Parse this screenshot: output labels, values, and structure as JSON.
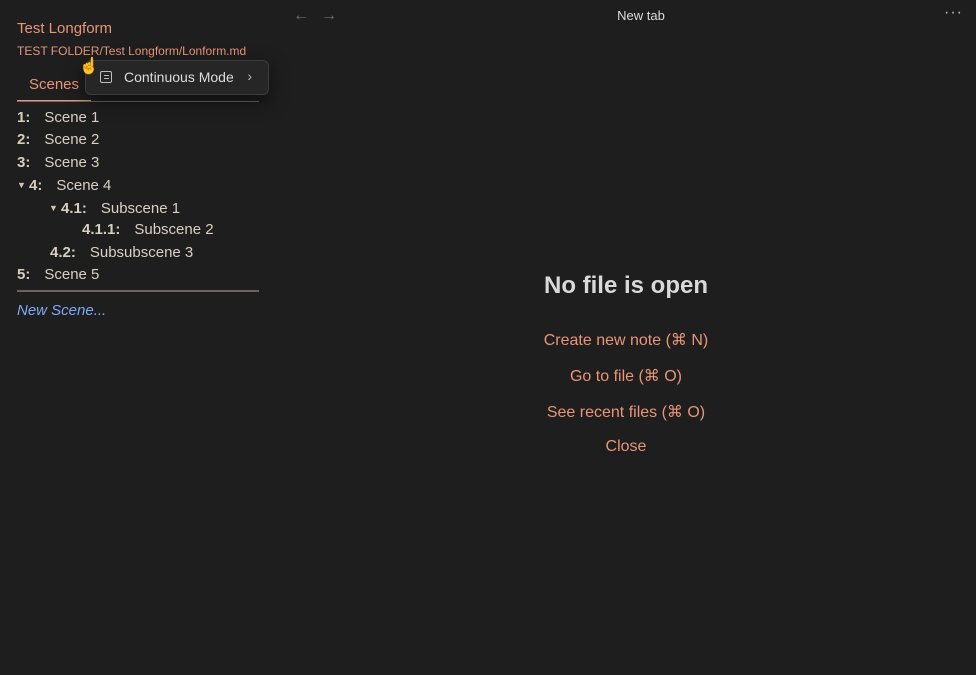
{
  "sidebar": {
    "project_title": "Test Longform",
    "project_path": "TEST FOLDER/Test Longform/Lonform.md",
    "tab_scenes": "Scenes",
    "scenes": [
      {
        "num": "1:",
        "name": "Scene 1",
        "toggle": ""
      },
      {
        "num": "2:",
        "name": "Scene 2",
        "toggle": ""
      },
      {
        "num": "3:",
        "name": "Scene 3",
        "toggle": ""
      },
      {
        "num": "4:",
        "name": "Scene 4",
        "toggle": "▼"
      },
      {
        "num": "4.1:",
        "name": "Subscene 1",
        "toggle": "▼"
      },
      {
        "num": "4.1.1:",
        "name": "Subscene 2",
        "toggle": ""
      },
      {
        "num": "4.2:",
        "name": "Subsubscene 3",
        "toggle": ""
      },
      {
        "num": "5:",
        "name": "Scene 5",
        "toggle": ""
      }
    ],
    "new_scene": "New Scene..."
  },
  "menu": {
    "item_label": "Continuous Mode",
    "item_icon": "scroll-icon",
    "chevron": "›"
  },
  "header": {
    "back": "←",
    "forward": "→",
    "tab_title": "New tab",
    "more": "···"
  },
  "main": {
    "empty_title": "No file is open",
    "actions": [
      "Create new note (⌘ N)",
      "Go to file (⌘ O)",
      "See recent files (⌘ O)",
      "Close"
    ]
  },
  "colors": {
    "accent": "#e8957a",
    "link": "#7fa9f5",
    "background": "#1e1e1e"
  }
}
